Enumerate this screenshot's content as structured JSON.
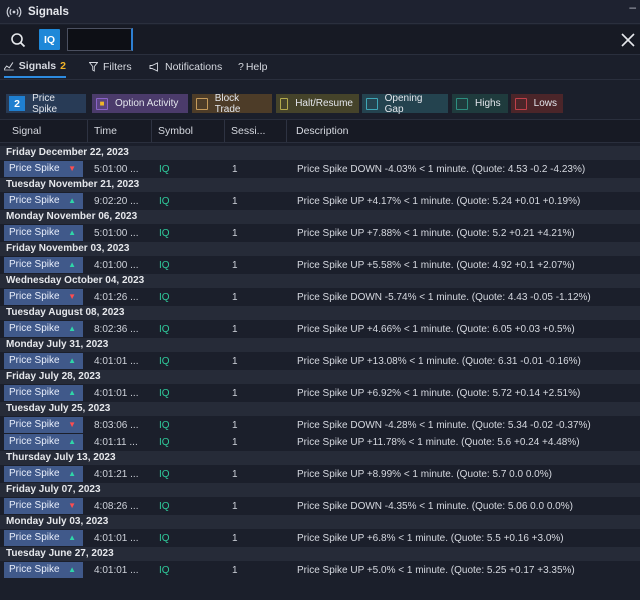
{
  "window": {
    "title": "Signals",
    "minimize_label": "–"
  },
  "search": {
    "symbol_badge": "IQ",
    "input_value": "",
    "input_placeholder": ""
  },
  "tabs": [
    {
      "label": "Signals",
      "count": "2",
      "icon": "chart-line-icon"
    },
    {
      "label": "Filters",
      "icon": "filter-icon"
    },
    {
      "label": "Notifications",
      "icon": "megaphone-icon"
    },
    {
      "label": "Help",
      "icon": "question-icon"
    }
  ],
  "filters": [
    {
      "label": "Price Spike",
      "badge": "2",
      "color": "#1f7fd0",
      "bg": ""
    },
    {
      "label": "Option Activity",
      "color": "#8a63c9",
      "bg": "#4b3b6b",
      "icon": "lock-icon"
    },
    {
      "label": "Block Trade",
      "color": "#c59a5b",
      "bg": "#4d3c28"
    },
    {
      "label": "Halt/Resume",
      "color": "#b3aa4d",
      "bg": "#45432a"
    },
    {
      "label": "Opening Gap",
      "color": "#3fa6b6",
      "bg": "#24434f"
    },
    {
      "label": "Highs",
      "color": "#2e8e80",
      "bg": "#1f3b3d"
    },
    {
      "label": "Lows",
      "color": "#c0404a",
      "bg": "#4b2529"
    }
  ],
  "columns": [
    "Signal",
    "Time",
    "Symbol",
    "Sessi...",
    "Description"
  ],
  "groups": [
    {
      "date": "Friday December 22, 2023",
      "rows": [
        {
          "signal": "Price Spike",
          "dir": "down",
          "time": "5:01:00 ...",
          "symbol": "IQ",
          "session": "1",
          "desc": "Price Spike DOWN -4.03% < 1 minute. (Quote: 4.53 -0.2 -4.23%)"
        }
      ]
    },
    {
      "date": "Tuesday November 21, 2023",
      "rows": [
        {
          "signal": "Price Spike",
          "dir": "up",
          "time": "9:02:20 ...",
          "symbol": "IQ",
          "session": "1",
          "desc": "Price Spike UP +4.17% < 1 minute. (Quote: 5.24 +0.01 +0.19%)"
        }
      ]
    },
    {
      "date": "Monday November 06, 2023",
      "rows": [
        {
          "signal": "Price Spike",
          "dir": "up",
          "time": "5:01:00 ...",
          "symbol": "IQ",
          "session": "1",
          "desc": "Price Spike UP +7.88% < 1 minute. (Quote: 5.2 +0.21 +4.21%)"
        }
      ]
    },
    {
      "date": "Friday November 03, 2023",
      "rows": [
        {
          "signal": "Price Spike",
          "dir": "up",
          "time": "4:01:00 ...",
          "symbol": "IQ",
          "session": "1",
          "desc": "Price Spike UP +5.58% < 1 minute. (Quote: 4.92 +0.1 +2.07%)"
        }
      ]
    },
    {
      "date": "Wednesday October 04, 2023",
      "rows": [
        {
          "signal": "Price Spike",
          "dir": "down",
          "time": "4:01:26 ...",
          "symbol": "IQ",
          "session": "1",
          "desc": "Price Spike DOWN -5.74% < 1 minute. (Quote: 4.43 -0.05 -1.12%)"
        }
      ]
    },
    {
      "date": "Tuesday August 08, 2023",
      "rows": [
        {
          "signal": "Price Spike",
          "dir": "up",
          "time": "8:02:36 ...",
          "symbol": "IQ",
          "session": "1",
          "desc": "Price Spike UP +4.66% < 1 minute. (Quote: 6.05 +0.03 +0.5%)"
        }
      ]
    },
    {
      "date": "Monday July 31, 2023",
      "rows": [
        {
          "signal": "Price Spike",
          "dir": "up",
          "time": "4:01:01 ...",
          "symbol": "IQ",
          "session": "1",
          "desc": "Price Spike UP +13.08% < 1 minute. (Quote: 6.31 -0.01 -0.16%)"
        }
      ]
    },
    {
      "date": "Friday July 28, 2023",
      "rows": [
        {
          "signal": "Price Spike",
          "dir": "up",
          "time": "4:01:01 ...",
          "symbol": "IQ",
          "session": "1",
          "desc": "Price Spike UP +6.92% < 1 minute. (Quote: 5.72 +0.14 +2.51%)"
        }
      ]
    },
    {
      "date": "Tuesday July 25, 2023",
      "rows": [
        {
          "signal": "Price Spike",
          "dir": "down",
          "time": "8:03:06 ...",
          "symbol": "IQ",
          "session": "1",
          "desc": "Price Spike DOWN -4.28% < 1 minute. (Quote: 5.34 -0.02 -0.37%)"
        },
        {
          "signal": "Price Spike",
          "dir": "up",
          "time": "4:01:11 ...",
          "symbol": "IQ",
          "session": "1",
          "desc": "Price Spike UP +11.78% < 1 minute. (Quote: 5.6 +0.24 +4.48%)"
        }
      ]
    },
    {
      "date": "Thursday July 13, 2023",
      "rows": [
        {
          "signal": "Price Spike",
          "dir": "up",
          "time": "4:01:21 ...",
          "symbol": "IQ",
          "session": "1",
          "desc": "Price Spike UP +8.99% < 1 minute. (Quote: 5.7 0.0 0.0%)"
        }
      ]
    },
    {
      "date": "Friday July 07, 2023",
      "rows": [
        {
          "signal": "Price Spike",
          "dir": "down",
          "time": "4:08:26 ...",
          "symbol": "IQ",
          "session": "1",
          "desc": "Price Spike DOWN -4.35% < 1 minute. (Quote: 5.06 0.0 0.0%)"
        }
      ]
    },
    {
      "date": "Monday July 03, 2023",
      "rows": [
        {
          "signal": "Price Spike",
          "dir": "up",
          "time": "4:01:01 ...",
          "symbol": "IQ",
          "session": "1",
          "desc": "Price Spike UP +6.8% < 1 minute. (Quote: 5.5 +0.16 +3.0%)"
        }
      ]
    },
    {
      "date": "Tuesday June 27, 2023",
      "rows": [
        {
          "signal": "Price Spike",
          "dir": "up",
          "time": "4:01:01 ...",
          "symbol": "IQ",
          "session": "1",
          "desc": "Price Spike UP +5.0% < 1 minute. (Quote: 5.25 +0.17 +3.35%)"
        }
      ]
    }
  ]
}
